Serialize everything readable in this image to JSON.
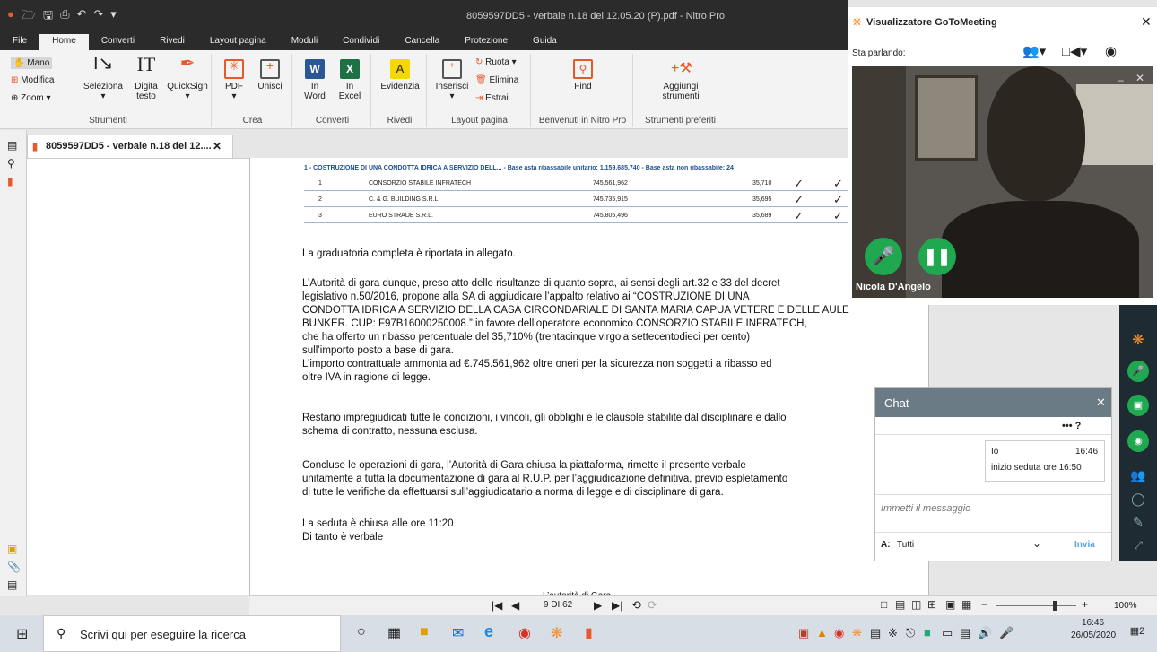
{
  "app": {
    "window_title": "8059597DD5 - verbale n.18 del 12.05.20 (P).pdf - Nitro Pro",
    "tabs": [
      "File",
      "Home",
      "Converti",
      "Rivedi",
      "Layout pagina",
      "Moduli",
      "Condividi",
      "Cancella",
      "Protezione",
      "Guida"
    ],
    "active_tab": "Home"
  },
  "ribbon": {
    "mano": "Mano",
    "modifica": "Modifica",
    "zoom": "Zoom",
    "seleziona": "Seleziona",
    "digita_testo_1": "Digita",
    "digita_testo_2": "testo",
    "quicksign": "QuickSign",
    "strumenti": "Strumenti",
    "pdf": "PDF",
    "unisci": "Unisci",
    "crea": "Crea",
    "in_word_1": "In",
    "in_word_2": "Word",
    "in_excel_1": "In",
    "in_excel_2": "Excel",
    "converti": "Converti",
    "evidenzia": "Evidenzia",
    "rivedi": "Rivedi",
    "inserisci": "Inserisci",
    "ruota": "Ruota",
    "elimina": "Elimina",
    "estrai": "Estrai",
    "layout_pagina": "Layout pagina",
    "find": "Find",
    "benvenuti": "Benvenuti in Nitro Pro",
    "aggiungi_1": "Aggiungi",
    "aggiungi_2": "strumenti",
    "strumenti_preferiti": "Strumenti preferiti"
  },
  "document": {
    "tab_title": "8059597DD5 - verbale n.18 del 12....",
    "table_header": "1 - COSTRUZIONE DI UNA CONDOTTA IDRICA A SERVIZIO DELL... - Base asta ribassabile unitario: 1.159.685,740 - Base asta non ribassabile: 24",
    "rows": [
      {
        "n": "1",
        "name": "CONSORZIO STABILE INFRATECH",
        "amount": "745.561,962",
        "pct": "35,710"
      },
      {
        "n": "2",
        "name": "C. & G. BUILDING S.R.L.",
        "amount": "745.735,915",
        "pct": "35,695"
      },
      {
        "n": "3",
        "name": "EURO STRADE S.R.L.",
        "amount": "745.805,496",
        "pct": "35,689"
      }
    ],
    "para1": "La graduatoria completa è riportata in allegato.",
    "para2_l1": "L’Autorità di gara dunque, preso atto delle risultanze di quanto sopra, ai sensi degli art.32 e 33 del decret",
    "para2_l2": "legislativo n.50/2016, propone alla SA di aggiudicare l’appalto relativo ai “COSTRUZIONE DI UNA",
    "para2_l3": "CONDOTTA IDRICA A SERVIZIO DELLA CASA CIRCONDARIALE DI SANTA MARIA CAPUA VETERE E DELLE AULE",
    "para2_l4": "BUNKER. CUP: F97B16000250008.” in favore dell’operatore economico CONSORZIO STABILE INFRATECH,",
    "para2_l5": "che ha offerto un ribasso percentuale del 35,710% (trentacinque virgola settecentodieci per cento)",
    "para2_l6": "sull’importo posto a base di gara.",
    "para2_l7": "L’importo contrattuale ammonta ad €.745.561,962 oltre oneri per la sicurezza non soggetti a ribasso ed",
    "para2_l8": "oltre IVA in ragione di legge.",
    "para3_l1": "Restano impregiudicati tutte le condizioni, i vincoli, gli obblighi e le clausole stabilite dal disciplinare e dallo",
    "para3_l2": "schema di contratto, nessuna esclusa.",
    "para4_l1": "Concluse le operazioni di gara, l’Autorità di Gara chiusa la piattaforma, rimette il presente verbale",
    "para4_l2": "unitamente a tutta la documentazione di gara al R.U.P. per l’aggiudicazione definitiva, previo espletamento",
    "para4_l3": "di tutte le verifiche da effettuarsi sull’aggiudicatario a norma di legge e di disciplinare di gara.",
    "para5_l1": "La seduta è chiusa alle ore 11:20",
    "para5_l2": "Di tanto è verbale",
    "cutoff": "L’autorità di Gara"
  },
  "navbar": {
    "page_indicator": "9 DI 62",
    "zoom": "100%"
  },
  "gotomeeting": {
    "title": "Visualizzatore GoToMeeting",
    "speaking_label": "Sta parlando:",
    "participant": "Nicola D'Angelo"
  },
  "chat": {
    "title": "Chat",
    "more": "••• ?",
    "sender": "Io",
    "time": "16:46",
    "message": "inizio seduta ore 16:50",
    "placeholder": "Immetti il messaggio",
    "to_label": "A:",
    "to_value": "Tutti",
    "send": "Invia"
  },
  "taskbar": {
    "search_placeholder": "Scrivi qui per eseguire la ricerca",
    "time": "16:46",
    "date": "26/05/2020",
    "notif": "2"
  },
  "colors": {
    "dark_chrome": "#2b2b2b",
    "ribbon_bg": "#f3f3f3",
    "gtm_orange": "#f68d2e",
    "green": "#1fa84f",
    "chat_header": "#6b7b86"
  }
}
